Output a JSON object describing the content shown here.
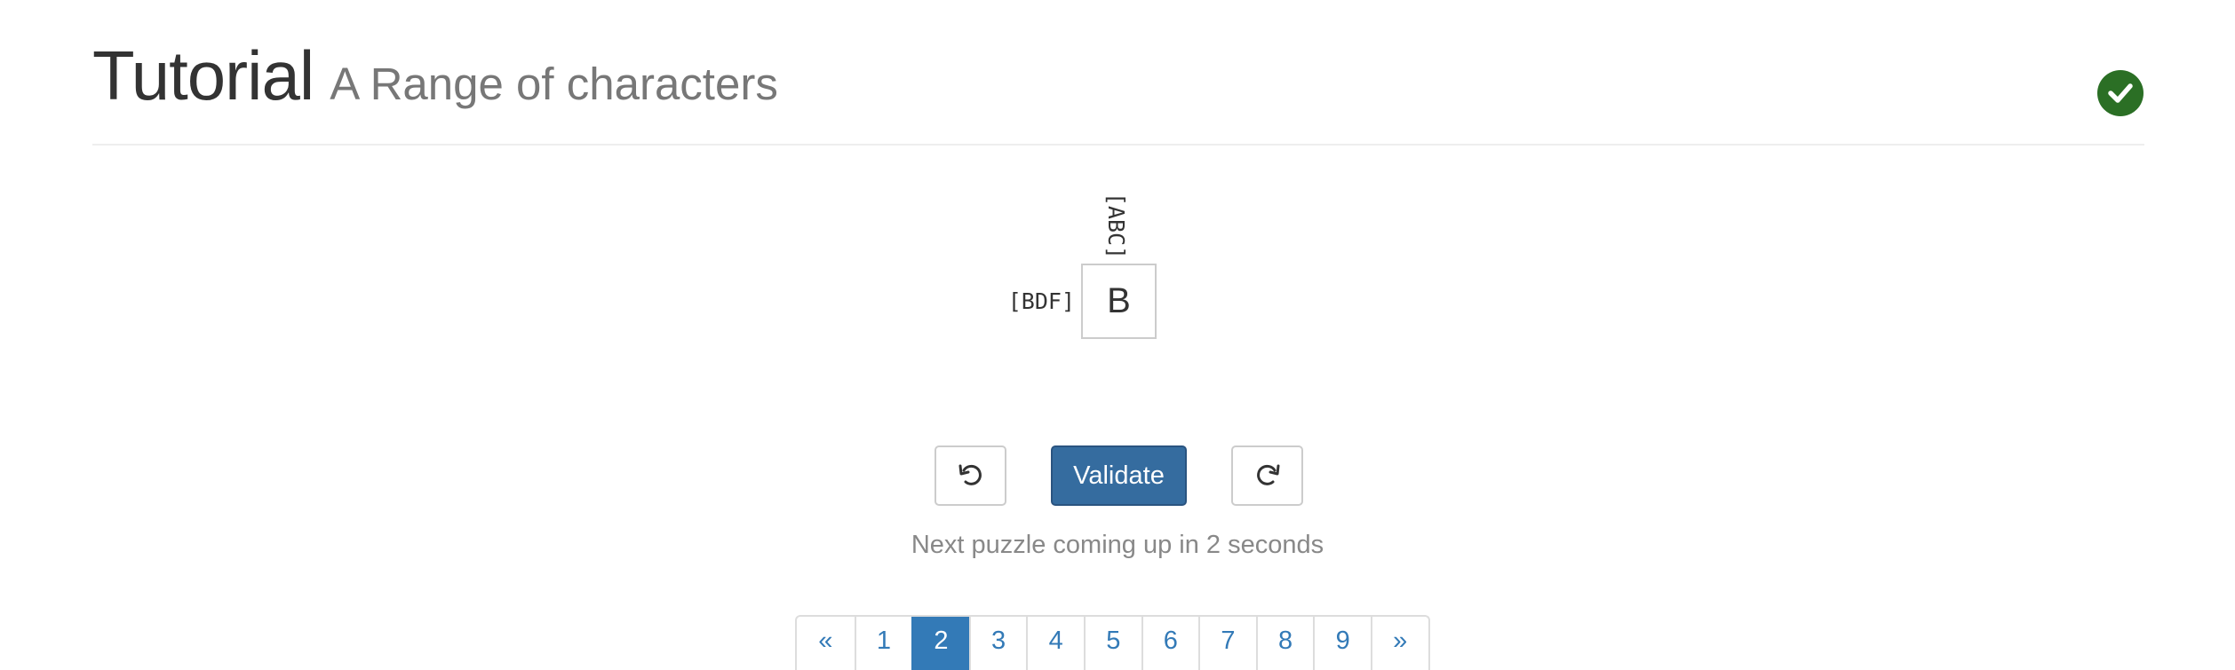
{
  "header": {
    "title": "Tutorial",
    "subtitle": "A Range of characters",
    "solved_icon": "check-circle-icon",
    "solved_color": "#2b6f25"
  },
  "puzzle": {
    "column_clues": [
      "[ABC]"
    ],
    "row_clues": [
      "[BDF]"
    ],
    "cells": [
      [
        "B"
      ]
    ]
  },
  "controls": {
    "undo_icon": "undo-icon",
    "validate_label": "Validate",
    "redo_icon": "redo-icon",
    "validate_color": "#356c9f"
  },
  "status": {
    "message": "Next puzzle coming up in 2 seconds"
  },
  "pagination": {
    "prev_label": "«",
    "next_label": "»",
    "pages": [
      "1",
      "2",
      "3",
      "4",
      "5",
      "6",
      "7",
      "8",
      "9"
    ],
    "active_page": "2",
    "link_color": "#337ab7"
  }
}
